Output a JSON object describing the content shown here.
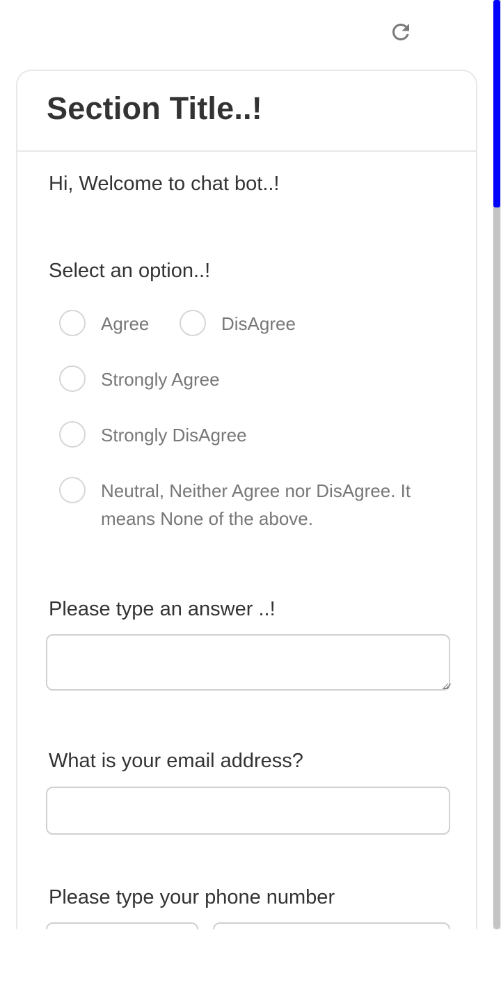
{
  "header": {
    "refresh_icon": "refresh-icon"
  },
  "section": {
    "title": "Section Title..!"
  },
  "welcome": "Hi, Welcome to chat bot..!",
  "question1": {
    "label": "Select an option..!",
    "options": [
      "Agree",
      "DisAgree",
      "Strongly Agree",
      "Strongly DisAgree",
      "Neutral, Neither Agree nor DisAgree. It means None of the above."
    ]
  },
  "question2": {
    "label": "Please type an answer ..!",
    "value": ""
  },
  "question3": {
    "label": "What is your email address?",
    "value": ""
  },
  "question4": {
    "label": "Please type your phone number",
    "code_value": "",
    "number_value": ""
  },
  "colors": {
    "scroll_thumb": "#0000ff",
    "card_border": "#e8e8e8",
    "text_primary": "#333333",
    "text_option": "#777777"
  }
}
